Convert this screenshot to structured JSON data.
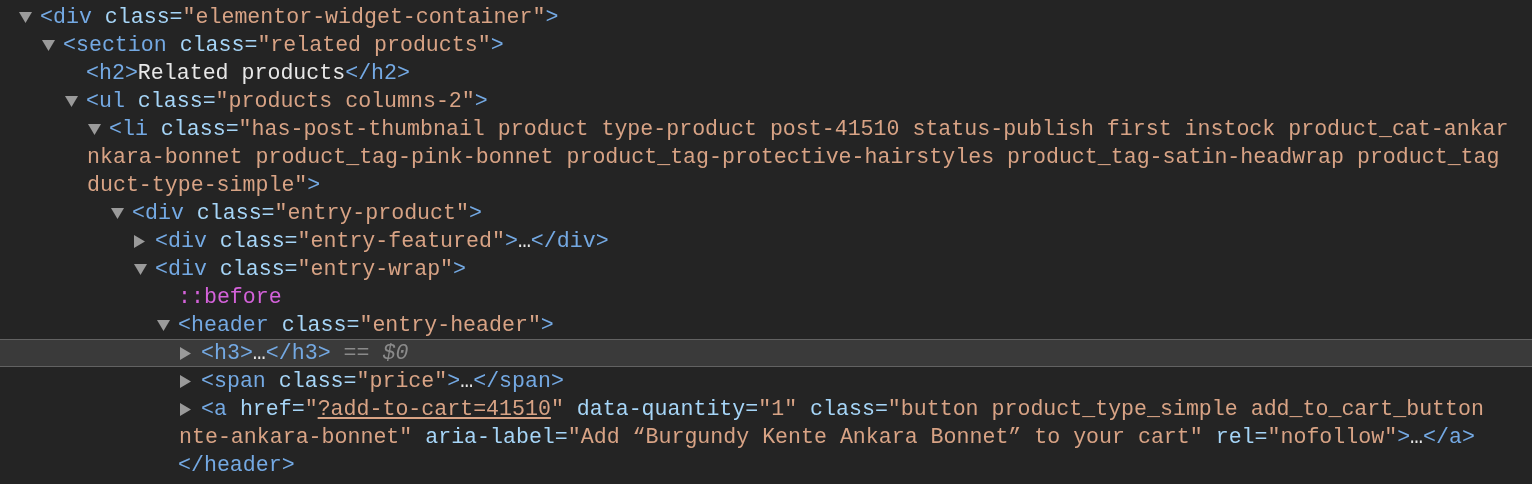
{
  "tree": [
    {
      "expandable": true,
      "expanded": true,
      "selected": false,
      "lines": [
        [
          {
            "kind": "tag",
            "text": "<div"
          },
          {
            "kind": "attr",
            "text": "class="
          },
          {
            "kind": "value",
            "text": "\"elementor-widget-container\""
          },
          {
            "kind": "tag",
            "text": ">"
          }
        ]
      ],
      "children": [
        {
          "expandable": true,
          "expanded": true,
          "selected": false,
          "lines": [
            [
              {
                "kind": "tag",
                "text": "<section"
              },
              {
                "kind": "attr",
                "text": "class="
              },
              {
                "kind": "value",
                "text": "\"related products\""
              },
              {
                "kind": "tag",
                "text": ">"
              }
            ]
          ],
          "children": [
            {
              "expandable": false,
              "selected": false,
              "lines": [
                [
                  {
                    "kind": "tag",
                    "text": "<h2>"
                  },
                  {
                    "kind": "text",
                    "text": "Related products"
                  },
                  {
                    "kind": "tag",
                    "text": "</h2>"
                  }
                ]
              ]
            },
            {
              "expandable": true,
              "expanded": true,
              "selected": false,
              "lines": [
                [
                  {
                    "kind": "tag",
                    "text": "<ul"
                  },
                  {
                    "kind": "attr",
                    "text": "class="
                  },
                  {
                    "kind": "value",
                    "text": "\"products columns-2\""
                  },
                  {
                    "kind": "tag",
                    "text": ">"
                  }
                ]
              ],
              "children": [
                {
                  "expandable": true,
                  "expanded": true,
                  "selected": false,
                  "lines": [
                    [
                      {
                        "kind": "tag",
                        "text": "<li"
                      },
                      {
                        "kind": "attr",
                        "text": "class="
                      },
                      {
                        "kind": "value",
                        "text": "\"has-post-thumbnail product type-product post-41510 status-publish first instock product_cat-ankar"
                      }
                    ],
                    [
                      {
                        "kind": "value",
                        "text": "nkara-bonnet product_tag-pink-bonnet product_tag-protective-hairstyles product_tag-satin-headwrap product_tag"
                      }
                    ],
                    [
                      {
                        "kind": "value",
                        "text": "duct-type-simple\""
                      },
                      {
                        "kind": "tag",
                        "text": ">"
                      }
                    ]
                  ],
                  "children": [
                    {
                      "expandable": true,
                      "expanded": true,
                      "selected": false,
                      "lines": [
                        [
                          {
                            "kind": "tag",
                            "text": "<div"
                          },
                          {
                            "kind": "attr",
                            "text": "class="
                          },
                          {
                            "kind": "value",
                            "text": "\"entry-product\""
                          },
                          {
                            "kind": "tag",
                            "text": ">"
                          }
                        ]
                      ],
                      "children": [
                        {
                          "expandable": true,
                          "expanded": false,
                          "selected": false,
                          "lines": [
                            [
                              {
                                "kind": "tag",
                                "text": "<div"
                              },
                              {
                                "kind": "attr",
                                "text": "class="
                              },
                              {
                                "kind": "value",
                                "text": "\"entry-featured\""
                              },
                              {
                                "kind": "tag",
                                "text": ">"
                              },
                              {
                                "kind": "text",
                                "text": "…"
                              },
                              {
                                "kind": "tag",
                                "text": "</div>"
                              }
                            ]
                          ]
                        },
                        {
                          "expandable": true,
                          "expanded": true,
                          "selected": false,
                          "lines": [
                            [
                              {
                                "kind": "tag",
                                "text": "<div"
                              },
                              {
                                "kind": "attr",
                                "text": "class="
                              },
                              {
                                "kind": "value",
                                "text": "\"entry-wrap\""
                              },
                              {
                                "kind": "tag",
                                "text": ">"
                              }
                            ]
                          ],
                          "children": [
                            {
                              "expandable": false,
                              "selected": false,
                              "lines": [
                                [
                                  {
                                    "kind": "pseudo",
                                    "text": "::before"
                                  }
                                ]
                              ]
                            },
                            {
                              "expandable": true,
                              "expanded": true,
                              "selected": false,
                              "lines": [
                                [
                                  {
                                    "kind": "tag",
                                    "text": "<header"
                                  },
                                  {
                                    "kind": "attr",
                                    "text": "class="
                                  },
                                  {
                                    "kind": "value",
                                    "text": "\"entry-header\""
                                  },
                                  {
                                    "kind": "tag",
                                    "text": ">"
                                  }
                                ]
                              ],
                              "children": [
                                {
                                  "expandable": true,
                                  "expanded": false,
                                  "selected": true,
                                  "lines": [
                                    [
                                      {
                                        "kind": "tag",
                                        "text": "<h3>"
                                      },
                                      {
                                        "kind": "text",
                                        "text": "…"
                                      },
                                      {
                                        "kind": "tag",
                                        "text": "</h3>"
                                      },
                                      {
                                        "kind": "marker",
                                        "text": "== $0"
                                      }
                                    ]
                                  ]
                                },
                                {
                                  "expandable": true,
                                  "expanded": false,
                                  "selected": false,
                                  "lines": [
                                    [
                                      {
                                        "kind": "tag",
                                        "text": "<span"
                                      },
                                      {
                                        "kind": "attr",
                                        "text": "class="
                                      },
                                      {
                                        "kind": "value",
                                        "text": "\"price\""
                                      },
                                      {
                                        "kind": "tag",
                                        "text": ">"
                                      },
                                      {
                                        "kind": "text",
                                        "text": "…"
                                      },
                                      {
                                        "kind": "tag",
                                        "text": "</span>"
                                      }
                                    ]
                                  ]
                                },
                                {
                                  "expandable": true,
                                  "expanded": false,
                                  "selected": false,
                                  "lines": [
                                    [
                                      {
                                        "kind": "tag",
                                        "text": "<a"
                                      },
                                      {
                                        "kind": "attr",
                                        "text": "href="
                                      },
                                      {
                                        "kind": "value",
                                        "text": "\""
                                      },
                                      {
                                        "kind": "link",
                                        "text": "?add-to-cart=41510"
                                      },
                                      {
                                        "kind": "value",
                                        "text": "\""
                                      },
                                      {
                                        "kind": "attr",
                                        "text": "data-quantity="
                                      },
                                      {
                                        "kind": "value",
                                        "text": "\"1\""
                                      },
                                      {
                                        "kind": "attr",
                                        "text": "class="
                                      },
                                      {
                                        "kind": "value",
                                        "text": "\"button product_type_simple add_to_cart_button"
                                      }
                                    ],
                                    [
                                      {
                                        "kind": "value",
                                        "text": "nte-ankara-bonnet\""
                                      },
                                      {
                                        "kind": "attr",
                                        "text": "aria-label="
                                      },
                                      {
                                        "kind": "value",
                                        "text": "\"Add “Burgundy Kente Ankara Bonnet” to your cart\""
                                      },
                                      {
                                        "kind": "attr",
                                        "text": "rel="
                                      },
                                      {
                                        "kind": "value",
                                        "text": "\"nofollow\""
                                      },
                                      {
                                        "kind": "tag",
                                        "text": ">"
                                      },
                                      {
                                        "kind": "text",
                                        "text": "…"
                                      },
                                      {
                                        "kind": "tag",
                                        "text": "</a>"
                                      }
                                    ]
                                  ]
                                }
                              ],
                              "close": [
                                {
                                  "kind": "tag",
                                  "text": "</header>"
                                }
                              ]
                            }
                          ]
                        }
                      ]
                    }
                  ]
                }
              ]
            }
          ]
        }
      ]
    }
  ]
}
